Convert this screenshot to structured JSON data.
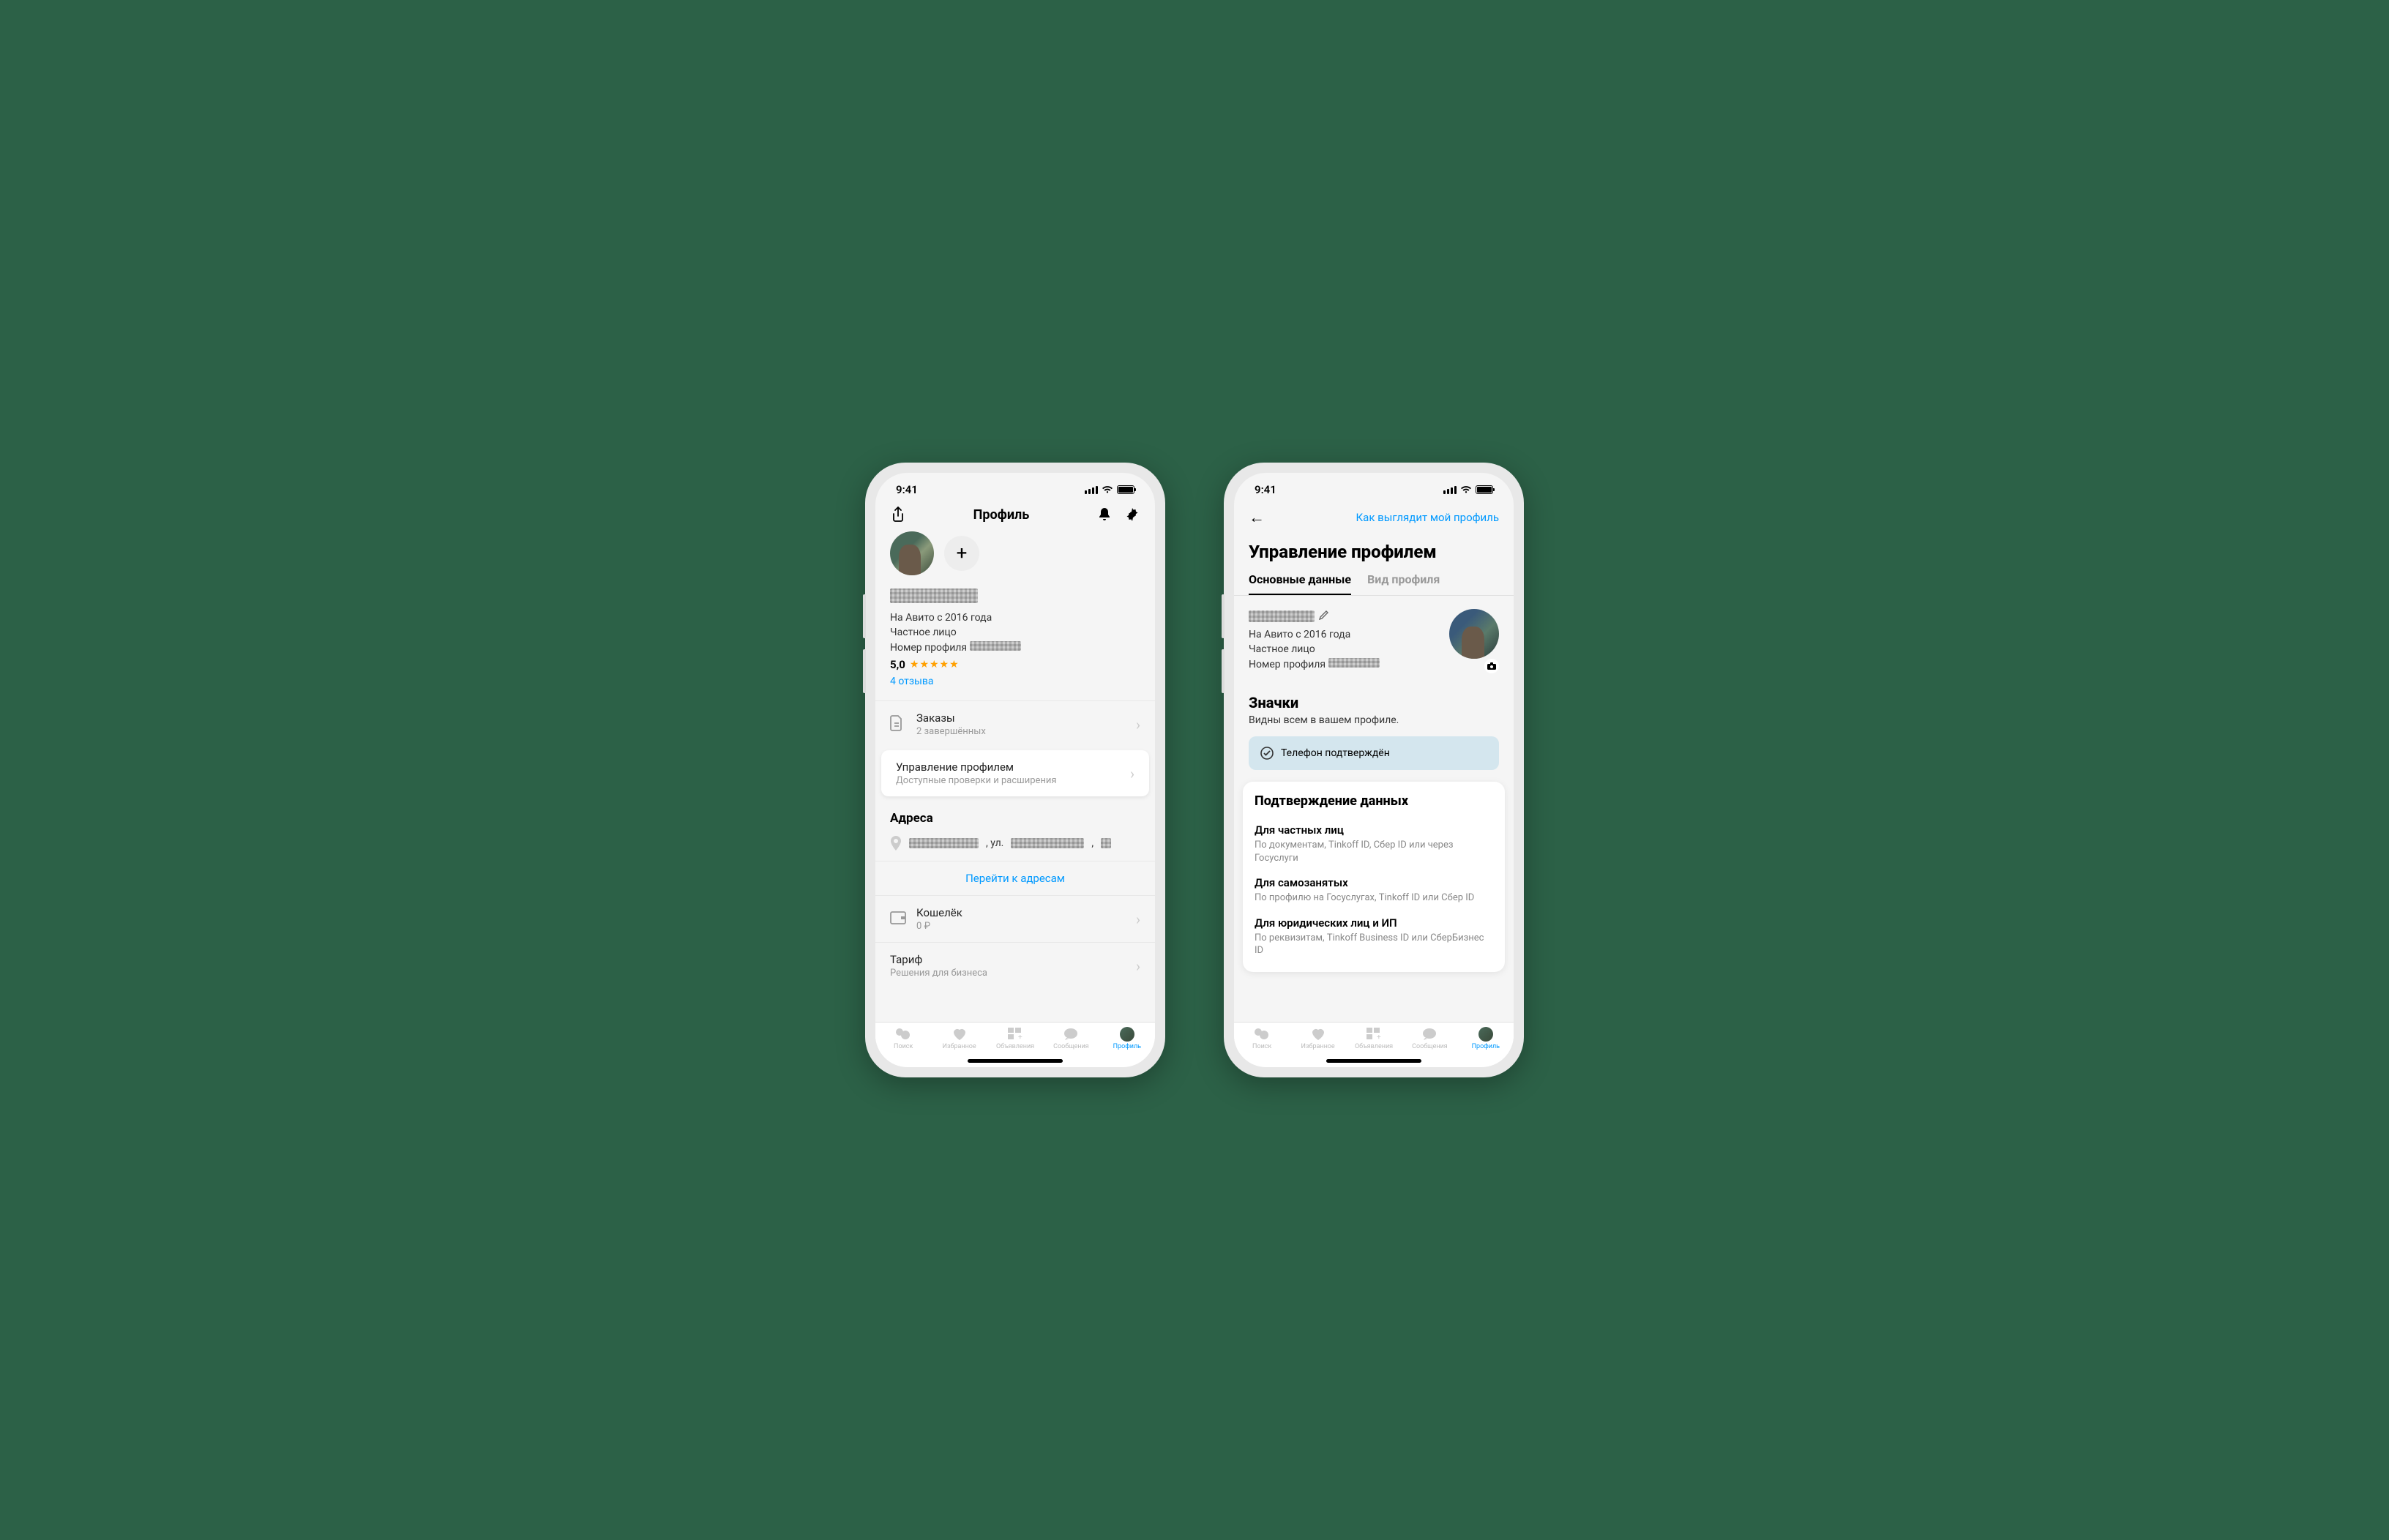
{
  "status": {
    "time": "9:41"
  },
  "phone1": {
    "header": {
      "title": "Профиль"
    },
    "profile": {
      "since": "На Авито с 2016 года",
      "type": "Частное лицо",
      "number_label": "Номер профиля",
      "rating": "5,0",
      "reviews": "4 отзыва"
    },
    "menu": {
      "orders": {
        "title": "Заказы",
        "sub": "2 завершённых"
      },
      "manage": {
        "title": "Управление профилем",
        "sub": "Доступные проверки и расширения"
      },
      "addresses_title": "Адреса",
      "address_street": ", ул.",
      "address_comma": ",",
      "goto_addresses": "Перейти к адресам",
      "wallet": {
        "title": "Кошелёк",
        "sub": "0 ₽"
      },
      "tariff": {
        "title": "Тариф",
        "sub": "Решения для бизнеса"
      }
    }
  },
  "phone2": {
    "header": {
      "preview_link": "Как выглядит мой профиль"
    },
    "title": "Управление профилем",
    "tabs": {
      "main": "Основные данные",
      "view": "Вид профиля"
    },
    "profile": {
      "since": "На Авито с 2016 года",
      "type": "Частное лицо",
      "number_label": "Номер профиля"
    },
    "badges": {
      "title": "Значки",
      "sub": "Видны всем в вашем профиле.",
      "phone_verified": "Телефон подтверждён"
    },
    "verification": {
      "title": "Подтверждение данных",
      "items": [
        {
          "title": "Для частных лиц",
          "sub": "По документам, Tinkoff ID, Сбер ID или через Госуслуги"
        },
        {
          "title": "Для самозанятых",
          "sub": "По профилю на Госуслугах, Tinkoff ID или Сбер ID"
        },
        {
          "title": "Для юридических лиц и ИП",
          "sub": "По реквизитам, Tinkoff Business ID или СберБизнес ID"
        }
      ]
    }
  },
  "tabbar": {
    "search": "Поиск",
    "favorites": "Избранное",
    "listings": "Объявления",
    "messages": "Сообщения",
    "profile": "Профиль"
  }
}
